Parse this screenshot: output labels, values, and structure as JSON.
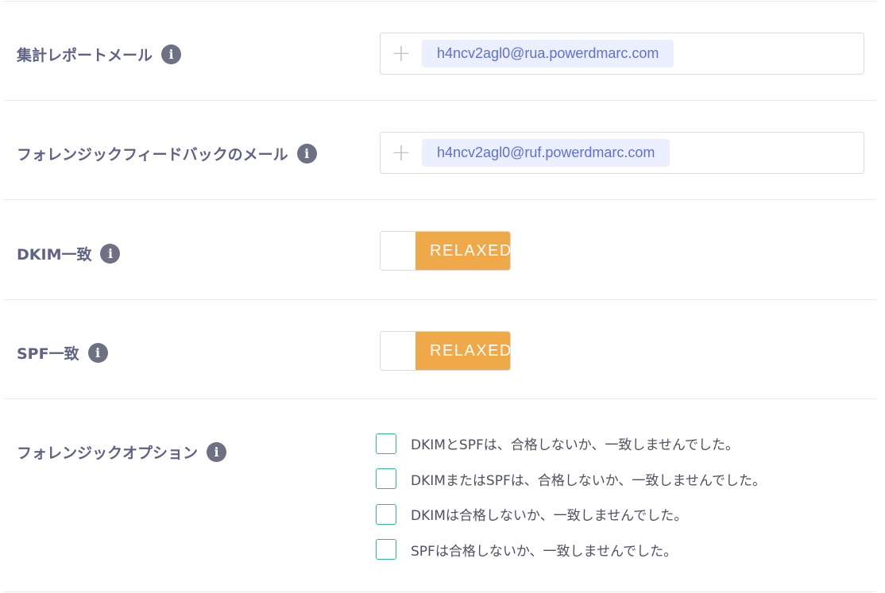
{
  "aggregate_report": {
    "label": "集計レポートメール",
    "info_icon": "i",
    "add_icon": "+",
    "email": "h4ncv2agl0@rua.powerdmarc.com"
  },
  "forensic_feedback": {
    "label": "フォレンジックフィードバックのメール",
    "info_icon": "i",
    "add_icon": "+",
    "email": "h4ncv2agl0@ruf.powerdmarc.com"
  },
  "dkim_alignment": {
    "label": "DKIM一致",
    "info_icon": "i",
    "value": "RELAXED",
    "accent_color": "#efa949"
  },
  "spf_alignment": {
    "label": "SPF一致",
    "info_icon": "i",
    "value": "RELAXED",
    "accent_color": "#efa949"
  },
  "forensic_options": {
    "label": "フォレンジックオプション",
    "info_icon": "i",
    "checkbox_color": "#2fb99c",
    "items": [
      {
        "label": "DKIMとSPFは、合格しないか、一致しませんでした。",
        "checked": false
      },
      {
        "label": "DKIMまたはSPFは、合格しないか、一致しませんでした。",
        "checked": false
      },
      {
        "label": "DKIMは合格しないか、一致しませんでした。",
        "checked": false
      },
      {
        "label": "SPFは合格しないか、一致しませんでした。",
        "checked": false
      }
    ]
  }
}
